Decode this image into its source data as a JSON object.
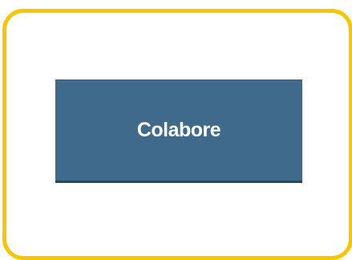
{
  "card": {
    "border_color": "#f7c600"
  },
  "cta": {
    "label": "Colabore",
    "background_color": "#406a8b",
    "text_color": "#ffffff"
  }
}
